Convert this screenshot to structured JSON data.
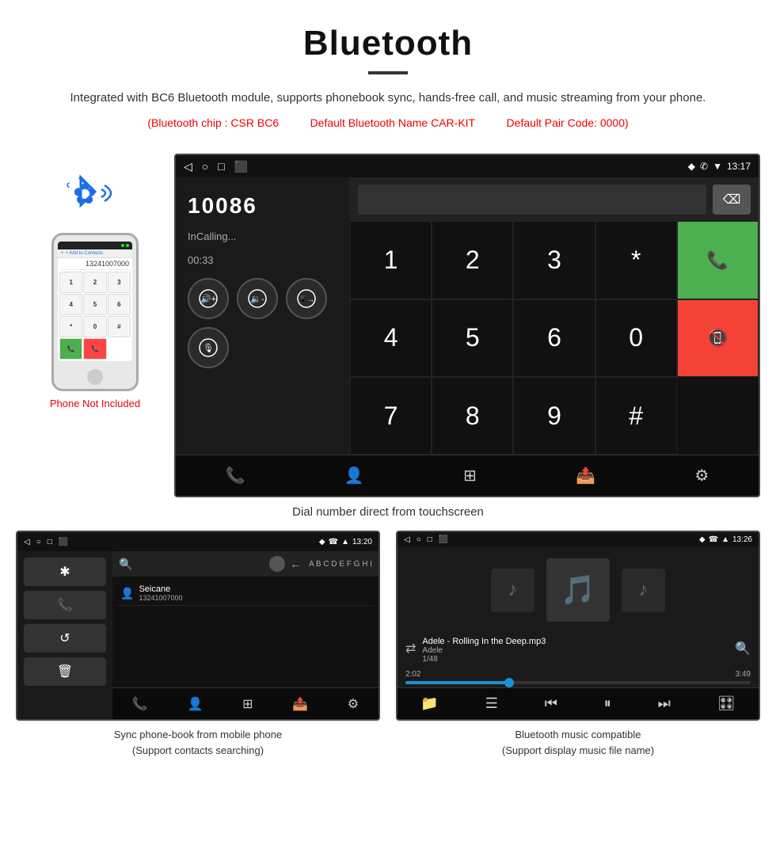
{
  "header": {
    "title": "Bluetooth",
    "description": "Integrated with BC6 Bluetooth module, supports phonebook sync, hands-free call, and music streaming from your phone.",
    "spec_chip": "(Bluetooth chip : CSR BC6",
    "spec_name": "Default Bluetooth Name CAR-KIT",
    "spec_code": "Default Pair Code: 0000)",
    "divider": true
  },
  "main_screen": {
    "status_bar": {
      "nav_back": "◁",
      "nav_home": "○",
      "nav_recent": "□",
      "nav_app": "⬛",
      "time": "13:17",
      "location_icon": "📍",
      "phone_icon": "📞",
      "wifi_icon": "▲"
    },
    "phone_number": "10086",
    "call_status": "InCalling...",
    "call_timer": "00:33",
    "keypad": {
      "keys": [
        "1",
        "2",
        "3",
        "*",
        "4",
        "5",
        "6",
        "0",
        "7",
        "8",
        "9",
        "#"
      ]
    },
    "bottom_icons": [
      "📞↕",
      "👤",
      "⊞",
      "📄↗",
      "⚙"
    ]
  },
  "main_caption": "Dial number direct from touchscreen",
  "phone_mockup": {
    "number": "13241007000",
    "keys": [
      "1",
      "2",
      "3",
      "4",
      "5",
      "6",
      "*",
      "0",
      "#"
    ],
    "add_contact": "+ Add to Contacts"
  },
  "phone_not_included": "Phone Not Included",
  "bottom_left": {
    "screen": {
      "status_bar": {
        "left": [
          "◁",
          "○",
          "□",
          "⬛"
        ],
        "right": [
          "📍",
          "📞",
          "▲",
          "13:20"
        ]
      },
      "contact_name": "Seicane",
      "contact_number": "13241007000",
      "menu_icons": [
        "✱",
        "📞",
        "↺",
        "🗑"
      ],
      "search_placeholder": "Search contacts",
      "bottom_icons": [
        "📞↕",
        "👤",
        "⊞",
        "📄",
        "⚙"
      ]
    },
    "caption_line1": "Sync phone-book from mobile phone",
    "caption_line2": "(Support contacts searching)"
  },
  "bottom_right": {
    "screen": {
      "status_bar": {
        "left": [
          "◁",
          "○",
          "□",
          "⬛"
        ],
        "right": [
          "📍",
          "📞",
          "▲",
          "13:26"
        ]
      },
      "track_name": "Adele - Rolling In the Deep.mp3",
      "artist": "Adele",
      "track_num": "1/48",
      "time_current": "2:02",
      "time_total": "3:49",
      "progress_pct": 30,
      "bottom_icons": [
        "📁",
        "☰",
        "⏮",
        "⏸",
        "⏭",
        "🎛"
      ]
    },
    "caption_line1": "Bluetooth music compatible",
    "caption_line2": "(Support display music file name)"
  }
}
